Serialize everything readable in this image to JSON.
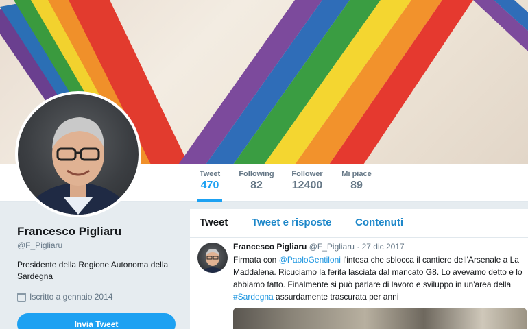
{
  "profile": {
    "name": "Francesco Pigliaru",
    "handle": "@F_Pigliaru",
    "bio": "Presidente della Regione Autonoma della Sardegna",
    "joined": "Iscritto a gennaio 2014",
    "button_label": "Invia Tweet"
  },
  "stats": [
    {
      "label": "Tweet",
      "value": "470"
    },
    {
      "label": "Following",
      "value": "82"
    },
    {
      "label": "Follower",
      "value": "12400"
    },
    {
      "label": "Mi piace",
      "value": "89"
    }
  ],
  "tabs": [
    {
      "label": "Tweet"
    },
    {
      "label": "Tweet e risposte"
    },
    {
      "label": "Contenuti"
    }
  ],
  "tweet": {
    "author": "Francesco Pigliaru",
    "handle_date": "@F_Pigliaru · 27 dic 2017",
    "text_1": "Firmata con ",
    "mention": "@PaoloGentiloni",
    "text_2": " l'intesa che sblocca il cantiere dell'Arsenale a La Maddalena. Ricuciamo la ferita lasciata dal mancato G8. Lo avevamo detto e lo abbiamo fatto. Finalmente si può parlare di lavoro e sviluppo in un'area della ",
    "hashtag": "#Sardegna",
    "text_3": " assurdamente trascurata per anni"
  },
  "colors": {
    "accent": "#1da1f2",
    "link": "#1b95e0",
    "background": "#e6ecf0"
  }
}
